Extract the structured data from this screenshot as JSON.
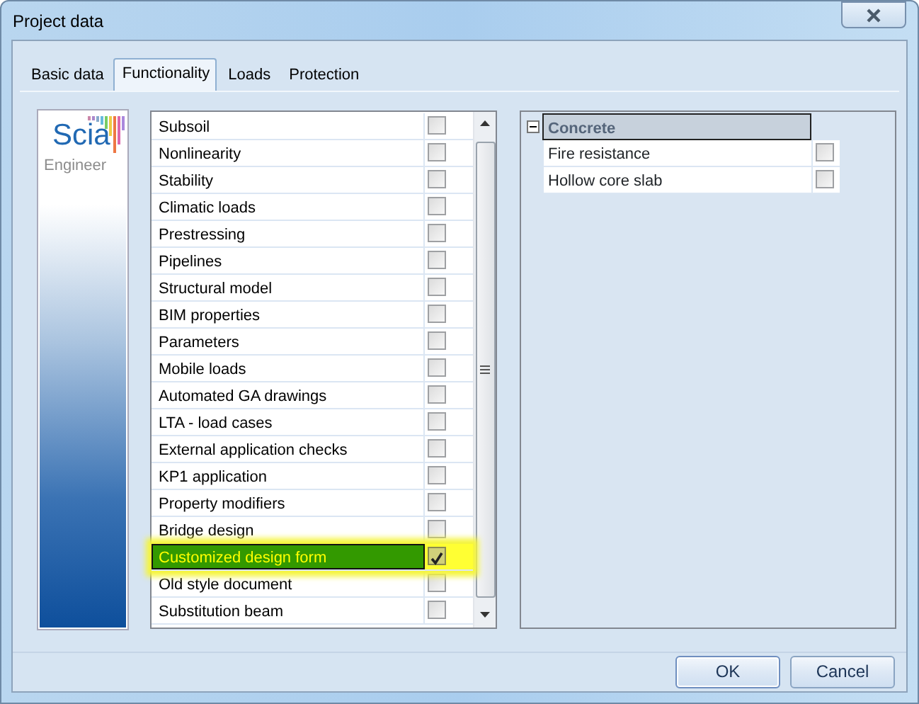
{
  "window": {
    "title": "Project data"
  },
  "tabs": [
    {
      "label": "Basic data",
      "selected": false
    },
    {
      "label": "Functionality",
      "selected": true
    },
    {
      "label": "Loads",
      "selected": false
    },
    {
      "label": "Protection",
      "selected": false
    }
  ],
  "logo": {
    "name": "Scia",
    "subtitle": "Engineer"
  },
  "functions": [
    {
      "label": "Subsoil",
      "checked": false,
      "selected": false,
      "highlighted": false
    },
    {
      "label": "Nonlinearity",
      "checked": false,
      "selected": false,
      "highlighted": false
    },
    {
      "label": "Stability",
      "checked": false,
      "selected": false,
      "highlighted": false
    },
    {
      "label": "Climatic loads",
      "checked": false,
      "selected": false,
      "highlighted": false
    },
    {
      "label": "Prestressing",
      "checked": false,
      "selected": false,
      "highlighted": false
    },
    {
      "label": "Pipelines",
      "checked": false,
      "selected": false,
      "highlighted": false
    },
    {
      "label": "Structural model",
      "checked": false,
      "selected": false,
      "highlighted": false
    },
    {
      "label": "BIM properties",
      "checked": false,
      "selected": false,
      "highlighted": false
    },
    {
      "label": "Parameters",
      "checked": false,
      "selected": false,
      "highlighted": false
    },
    {
      "label": "Mobile loads",
      "checked": false,
      "selected": false,
      "highlighted": false
    },
    {
      "label": "Automated GA drawings",
      "checked": false,
      "selected": false,
      "highlighted": false
    },
    {
      "label": "LTA - load cases",
      "checked": false,
      "selected": false,
      "highlighted": false
    },
    {
      "label": "External application checks",
      "checked": false,
      "selected": false,
      "highlighted": false
    },
    {
      "label": "KP1 application",
      "checked": false,
      "selected": false,
      "highlighted": false
    },
    {
      "label": "Property modifiers",
      "checked": false,
      "selected": false,
      "highlighted": false
    },
    {
      "label": "Bridge design",
      "checked": false,
      "selected": false,
      "highlighted": false
    },
    {
      "label": "Customized design form",
      "checked": true,
      "selected": true,
      "highlighted": true
    },
    {
      "label": "Old style document",
      "checked": false,
      "selected": false,
      "highlighted": false
    },
    {
      "label": "Substitution beam",
      "checked": false,
      "selected": false,
      "highlighted": false
    }
  ],
  "groups": [
    {
      "label": "Concrete",
      "expanded": true,
      "items": [
        {
          "label": "Fire resistance",
          "checked": false
        },
        {
          "label": "Hollow core slab",
          "checked": false
        }
      ]
    }
  ],
  "buttons": [
    "OK",
    "Cancel"
  ]
}
